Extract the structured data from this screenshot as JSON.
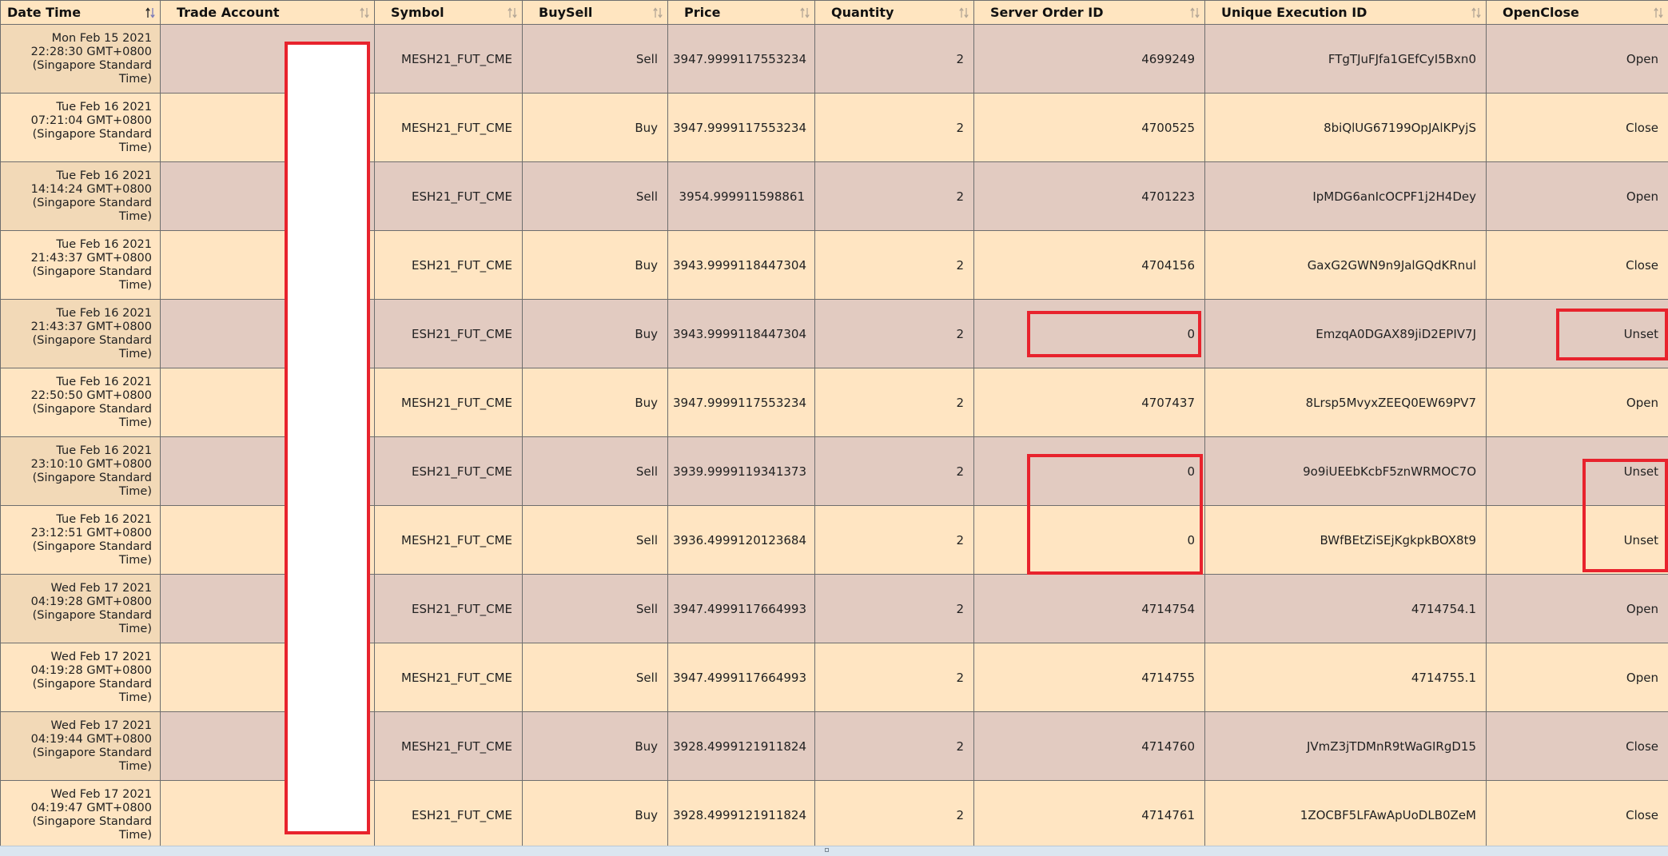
{
  "columns": [
    {
      "label": "Date Time",
      "sort": "asc"
    },
    {
      "label": "Trade Account",
      "sort": "none"
    },
    {
      "label": "Symbol",
      "sort": "none"
    },
    {
      "label": "BuySell",
      "sort": "none"
    },
    {
      "label": "Price",
      "sort": "none"
    },
    {
      "label": "Quantity",
      "sort": "none"
    },
    {
      "label": "Server Order ID",
      "sort": "none"
    },
    {
      "label": "Unique Execution ID",
      "sort": "none"
    },
    {
      "label": "OpenClose",
      "sort": "none"
    }
  ],
  "rows": [
    {
      "datetime": "Mon Feb 15 2021 22:28:30 GMT+0800 (Singapore Standard Time)",
      "account": "",
      "symbol": "MESH21_FUT_CME",
      "buysell": "Sell",
      "price": "3947.9999117553234",
      "quantity": "2",
      "server_order_id": "4699249",
      "execution_id": "FTgTJuFJfa1GEfCyI5Bxn0",
      "openclose": "Open"
    },
    {
      "datetime": "Tue Feb 16 2021 07:21:04 GMT+0800 (Singapore Standard Time)",
      "account": "",
      "symbol": "MESH21_FUT_CME",
      "buysell": "Buy",
      "price": "3947.9999117553234",
      "quantity": "2",
      "server_order_id": "4700525",
      "execution_id": "8biQlUG67199OpJAlKPyjS",
      "openclose": "Close"
    },
    {
      "datetime": "Tue Feb 16 2021 14:14:24 GMT+0800 (Singapore Standard Time)",
      "account": "",
      "symbol": "ESH21_FUT_CME",
      "buysell": "Sell",
      "price": "3954.999911598861",
      "quantity": "2",
      "server_order_id": "4701223",
      "execution_id": "IpMDG6anIcOCPF1j2H4Dey",
      "openclose": "Open"
    },
    {
      "datetime": "Tue Feb 16 2021 21:43:37 GMT+0800 (Singapore Standard Time)",
      "account": "",
      "symbol": "ESH21_FUT_CME",
      "buysell": "Buy",
      "price": "3943.9999118447304",
      "quantity": "2",
      "server_order_id": "4704156",
      "execution_id": "GaxG2GWN9n9JalGQdKRnul",
      "openclose": "Close"
    },
    {
      "datetime": "Tue Feb 16 2021 21:43:37 GMT+0800 (Singapore Standard Time)",
      "account": "",
      "symbol": "ESH21_FUT_CME",
      "buysell": "Buy",
      "price": "3943.9999118447304",
      "quantity": "2",
      "server_order_id": "0",
      "execution_id": "EmzqA0DGAX89jiD2EPIV7J",
      "openclose": "Unset"
    },
    {
      "datetime": "Tue Feb 16 2021 22:50:50 GMT+0800 (Singapore Standard Time)",
      "account": "",
      "symbol": "MESH21_FUT_CME",
      "buysell": "Buy",
      "price": "3947.9999117553234",
      "quantity": "2",
      "server_order_id": "4707437",
      "execution_id": "8Lrsp5MvyxZEEQ0EW69PV7",
      "openclose": "Open"
    },
    {
      "datetime": "Tue Feb 16 2021 23:10:10 GMT+0800 (Singapore Standard Time)",
      "account": "",
      "symbol": "ESH21_FUT_CME",
      "buysell": "Sell",
      "price": "3939.9999119341373",
      "quantity": "2",
      "server_order_id": "0",
      "execution_id": "9o9iUEEbKcbF5znWRMOC7O",
      "openclose": "Unset"
    },
    {
      "datetime": "Tue Feb 16 2021 23:12:51 GMT+0800 (Singapore Standard Time)",
      "account": "",
      "symbol": "MESH21_FUT_CME",
      "buysell": "Sell",
      "price": "3936.4999120123684",
      "quantity": "2",
      "server_order_id": "0",
      "execution_id": "BWfBEtZiSEjKgkpkBOX8t9",
      "openclose": "Unset"
    },
    {
      "datetime": "Wed Feb 17 2021 04:19:28 GMT+0800 (Singapore Standard Time)",
      "account": "",
      "symbol": "ESH21_FUT_CME",
      "buysell": "Sell",
      "price": "3947.4999117664993",
      "quantity": "2",
      "server_order_id": "4714754",
      "execution_id": "4714754.1",
      "openclose": "Open"
    },
    {
      "datetime": "Wed Feb 17 2021 04:19:28 GMT+0800 (Singapore Standard Time)",
      "account": "",
      "symbol": "MESH21_FUT_CME",
      "buysell": "Sell",
      "price": "3947.4999117664993",
      "quantity": "2",
      "server_order_id": "4714755",
      "execution_id": "4714755.1",
      "openclose": "Open"
    },
    {
      "datetime": "Wed Feb 17 2021 04:19:44 GMT+0800 (Singapore Standard Time)",
      "account": "",
      "symbol": "MESH21_FUT_CME",
      "buysell": "Buy",
      "price": "3928.4999121911824",
      "quantity": "2",
      "server_order_id": "4714760",
      "execution_id": "JVmZ3jTDMnR9tWaGIRgD15",
      "openclose": "Close"
    },
    {
      "datetime": "Wed Feb 17 2021 04:19:47 GMT+0800 (Singapore Standard Time)",
      "account": "",
      "symbol": "ESH21_FUT_CME",
      "buysell": "Buy",
      "price": "3928.4999121911824",
      "quantity": "2",
      "server_order_id": "4714761",
      "execution_id": "1ZOCBF5LFAwApUoDLB0ZeM",
      "openclose": "Close"
    }
  ],
  "colors": {
    "header_bg": "#ffe5c0",
    "row_odd": "#e2cbc1",
    "row_even": "#ffe5c2",
    "highlight": "#e8232d",
    "redaction": "#ffffff"
  }
}
